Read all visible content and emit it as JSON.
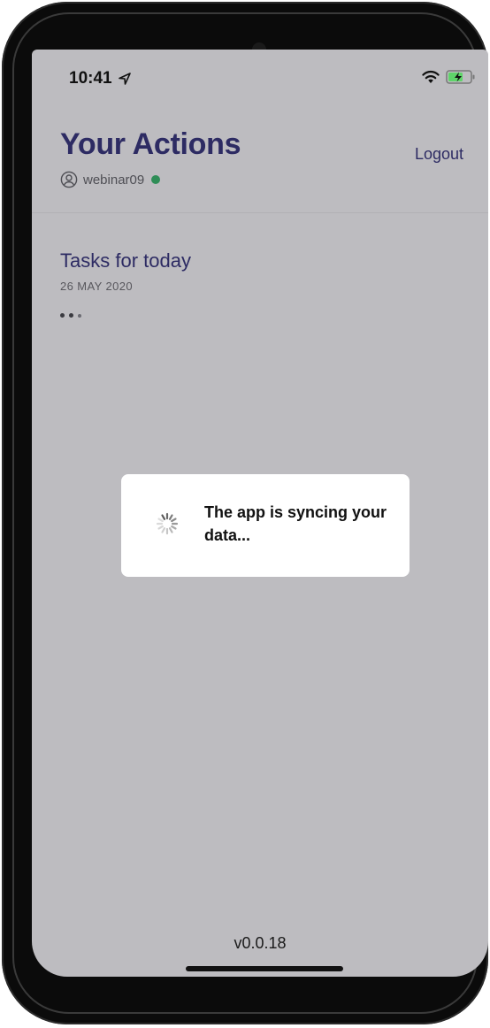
{
  "status_bar": {
    "time": "10:41",
    "icons": [
      "location-arrow-icon",
      "wifi-icon",
      "battery-charging-icon"
    ],
    "battery_color": "#5fd46a"
  },
  "header": {
    "title": "Your Actions",
    "username": "webinar09",
    "online_color": "#2f8d57",
    "logout_label": "Logout"
  },
  "content": {
    "section_title": "Tasks for today",
    "date": "26 MAY 2020"
  },
  "modal": {
    "message": "The app is syncing your data..."
  },
  "footer": {
    "version": "v0.0.18"
  },
  "colors": {
    "accent": "#2d2b63",
    "screen_bg": "#bdbcc0"
  }
}
